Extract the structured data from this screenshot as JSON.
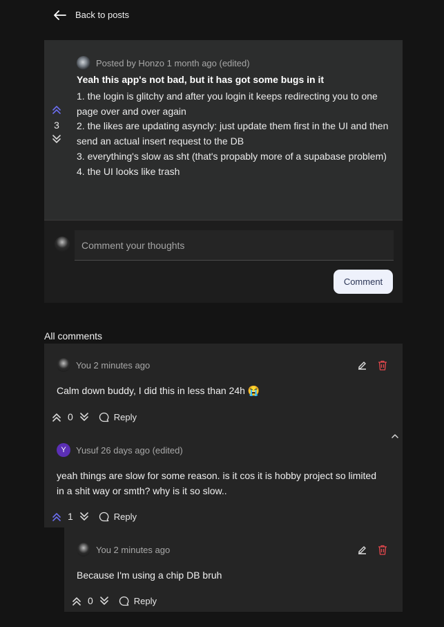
{
  "nav": {
    "back_label": "Back to posts"
  },
  "post": {
    "meta": "Posted by Honzo 1 month ago (edited)",
    "title": "Yeah this app's not bad, but it has got some bugs in it",
    "body_lines": [
      "1. the login is glitchy and after you login it keeps redirecting you to one page over and over again",
      "2. the likes are updating asyncly: just update them first in the UI and then send an actual insert request to the DB",
      "3. everything's slow as sht (that's propably more of a supabase problem)",
      "4. the UI looks like trash"
    ],
    "votes": "3"
  },
  "composer": {
    "placeholder": "Comment your thoughts",
    "button_label": "Comment"
  },
  "comments_section": {
    "title": "All comments"
  },
  "comments": [
    {
      "meta": "You 2 minutes ago",
      "text": "Calm down buddy, I did this in less than 24h 😭",
      "votes": "0",
      "reply_label": "Reply"
    },
    {
      "avatar_letter": "Y",
      "meta": "Yusuf 26 days ago (edited)",
      "text": "yeah things are slow for some reason. is it cos it is hobby project so limited in a shit way or smth? why is it so slow..",
      "votes": "1",
      "reply_label": "Reply"
    },
    {
      "meta": "You 2 minutes ago",
      "text": "Because I'm using a chip DB bruh",
      "votes": "0",
      "reply_label": "Reply"
    }
  ],
  "colors": {
    "accent_upvote": "#6b6ef0",
    "delete_red": "#e5484d",
    "button_bg": "#eef1fb",
    "yusuf_avatar": "#5b2fb5"
  }
}
